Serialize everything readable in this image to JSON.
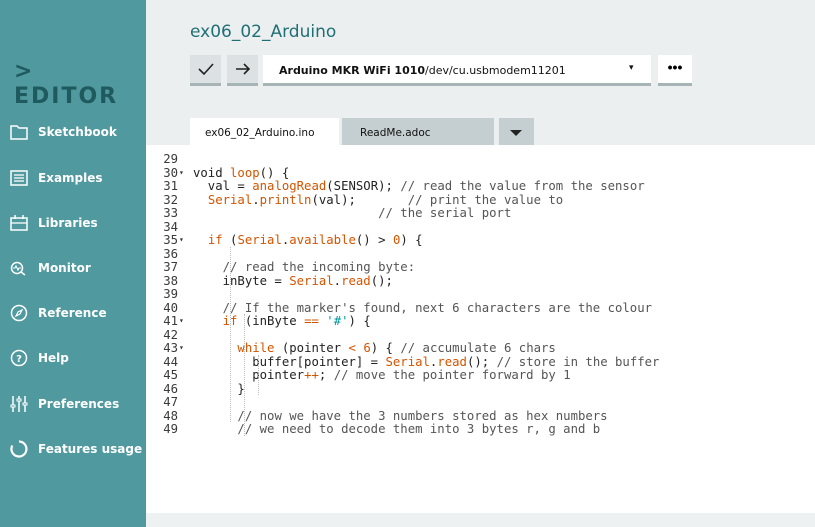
{
  "sidebar": {
    "brand": "> EDITOR",
    "items": [
      {
        "label": "Sketchbook",
        "icon": "folder-icon"
      },
      {
        "label": "Examples",
        "icon": "list-icon"
      },
      {
        "label": "Libraries",
        "icon": "library-icon"
      },
      {
        "label": "Monitor",
        "icon": "monitor-icon"
      },
      {
        "label": "Reference",
        "icon": "compass-icon"
      },
      {
        "label": "Help",
        "icon": "help-icon"
      },
      {
        "label": "Preferences",
        "icon": "sliders-icon"
      },
      {
        "label": "Features usage",
        "icon": "usage-icon"
      }
    ]
  },
  "header": {
    "project_title": "ex06_02_Arduino",
    "verify_icon": "checkmark-icon",
    "upload_icon": "arrow-right-icon",
    "board_name": "Arduino MKR WiFi 1010",
    "board_port": "/dev/cu.usbmodem11201",
    "board_caret": "▾",
    "more_label": "•••"
  },
  "tabs": [
    {
      "label": "ex06_02_Arduino.ino",
      "active": true
    },
    {
      "label": "ReadMe.adoc",
      "active": false
    }
  ],
  "colors": {
    "sidebar": "#4f999f",
    "brand": "#1f5a5e",
    "title": "#1f6f75",
    "keyword": "#d35400",
    "builtin": "#00979c",
    "comment": "#555555",
    "header_bg": "#eceff0"
  },
  "code": [
    {
      "num": "29",
      "fold": false,
      "segs": []
    },
    {
      "num": "30",
      "fold": true,
      "segs": [
        [
          "plain",
          "void "
        ],
        [
          "fn",
          "loop"
        ],
        [
          "plain",
          "() {"
        ]
      ]
    },
    {
      "num": "31",
      "fold": false,
      "segs": [
        [
          "plain",
          "  val = "
        ],
        [
          "fn",
          "analogRead"
        ],
        [
          "plain",
          "(SENSOR); "
        ],
        [
          "comment",
          "// read the value from the sensor"
        ]
      ]
    },
    {
      "num": "32",
      "fold": false,
      "segs": [
        [
          "plain",
          "  "
        ],
        [
          "fn",
          "Serial"
        ],
        [
          "plain",
          "."
        ],
        [
          "fn",
          "println"
        ],
        [
          "plain",
          "(val);       "
        ],
        [
          "comment",
          "// print the value to"
        ]
      ]
    },
    {
      "num": "33",
      "fold": false,
      "segs": [
        [
          "plain",
          "                         "
        ],
        [
          "comment",
          "// the serial port"
        ]
      ]
    },
    {
      "num": "34",
      "fold": false,
      "segs": []
    },
    {
      "num": "35",
      "fold": true,
      "segs": [
        [
          "plain",
          "  "
        ],
        [
          "kw",
          "if"
        ],
        [
          "plain",
          " ("
        ],
        [
          "fn",
          "Serial"
        ],
        [
          "plain",
          "."
        ],
        [
          "fn",
          "available"
        ],
        [
          "plain",
          "() > "
        ],
        [
          "num",
          "0"
        ],
        [
          "plain",
          ") {"
        ]
      ]
    },
    {
      "num": "36",
      "fold": false,
      "segs": []
    },
    {
      "num": "37",
      "fold": false,
      "segs": [
        [
          "plain",
          "    "
        ],
        [
          "comment",
          "// read the incoming byte:"
        ]
      ]
    },
    {
      "num": "38",
      "fold": false,
      "segs": [
        [
          "plain",
          "    inByte = "
        ],
        [
          "fn",
          "Serial"
        ],
        [
          "plain",
          "."
        ],
        [
          "fn",
          "read"
        ],
        [
          "plain",
          "();"
        ]
      ]
    },
    {
      "num": "39",
      "fold": false,
      "segs": []
    },
    {
      "num": "40",
      "fold": false,
      "segs": [
        [
          "plain",
          "    "
        ],
        [
          "comment",
          "// If the marker's found, next 6 characters are the colour"
        ]
      ]
    },
    {
      "num": "41",
      "fold": true,
      "segs": [
        [
          "plain",
          "    "
        ],
        [
          "kw",
          "if"
        ],
        [
          "plain",
          " (inByte "
        ],
        [
          "kw",
          "=="
        ],
        [
          "plain",
          " "
        ],
        [
          "str",
          "'#'"
        ],
        [
          "plain",
          ") {"
        ]
      ]
    },
    {
      "num": "42",
      "fold": false,
      "segs": []
    },
    {
      "num": "43",
      "fold": true,
      "segs": [
        [
          "plain",
          "      "
        ],
        [
          "kw",
          "while"
        ],
        [
          "plain",
          " (pointer "
        ],
        [
          "kw",
          "<"
        ],
        [
          "plain",
          " "
        ],
        [
          "num",
          "6"
        ],
        [
          "plain",
          ") { "
        ],
        [
          "comment",
          "// accumulate 6 chars"
        ]
      ]
    },
    {
      "num": "44",
      "fold": false,
      "segs": [
        [
          "plain",
          "        buffer[pointer] = "
        ],
        [
          "fn",
          "Serial"
        ],
        [
          "plain",
          "."
        ],
        [
          "fn",
          "read"
        ],
        [
          "plain",
          "(); "
        ],
        [
          "comment",
          "// store in the buffer"
        ]
      ]
    },
    {
      "num": "45",
      "fold": false,
      "segs": [
        [
          "plain",
          "        pointer"
        ],
        [
          "kw",
          "++"
        ],
        [
          "plain",
          "; "
        ],
        [
          "comment",
          "// move the pointer forward by 1"
        ]
      ]
    },
    {
      "num": "46",
      "fold": false,
      "segs": [
        [
          "plain",
          "      }"
        ]
      ]
    },
    {
      "num": "47",
      "fold": false,
      "segs": []
    },
    {
      "num": "48",
      "fold": false,
      "segs": [
        [
          "plain",
          "      "
        ],
        [
          "comment",
          "// now we have the 3 numbers stored as hex numbers"
        ]
      ]
    },
    {
      "num": "49",
      "fold": false,
      "segs": [
        [
          "plain",
          "      "
        ],
        [
          "comment",
          "// we need to decode them into 3 bytes r, g and b"
        ]
      ]
    }
  ]
}
